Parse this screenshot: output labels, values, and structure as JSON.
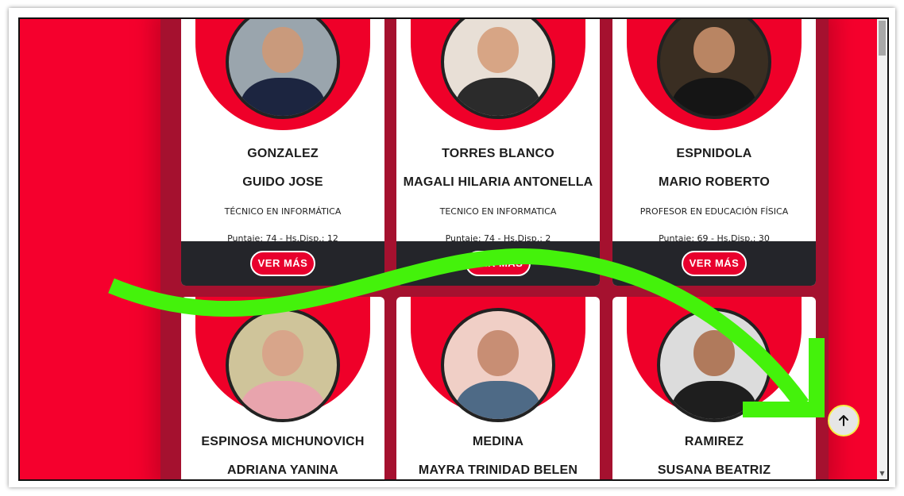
{
  "cards": [
    {
      "last": "GONZALEZ",
      "first": "GUIDO JOSE",
      "title": "TÉCNICO EN INFORMÁTICA",
      "meta": "Puntaje: 74 - Hs.Disp.: 12",
      "button": "VER MÁS"
    },
    {
      "last": "TORRES BLANCO",
      "first": "MAGALI HILARIA ANTONELLA",
      "title": "TECNICO EN INFORMATICA",
      "meta": "Puntaje: 74 - Hs.Disp.: 2",
      "button": "VER MÁS"
    },
    {
      "last": "ESPNIDOLA",
      "first": "MARIO ROBERTO",
      "title": "PROFESOR EN EDUCACIÓN FÍSICA",
      "meta": "Puntaje: 69 - Hs.Disp.: 30",
      "button": "VER MÁS"
    },
    {
      "last": "ESPINOSA MICHUNOVICH",
      "first": "ADRIANA YANINA"
    },
    {
      "last": "MEDINA",
      "first": "MAYRA TRINIDAD BELEN"
    },
    {
      "last": "RAMIREZ",
      "first": "SUSANA BEATRIZ"
    }
  ],
  "icons": {
    "back_to_top": "arrow-up-icon",
    "annotation": "curved-arrow-icon"
  },
  "colors": {
    "accent": "#ef0029",
    "band": "#a5112f",
    "footer": "#24252a",
    "annotation": "#44f20b"
  }
}
